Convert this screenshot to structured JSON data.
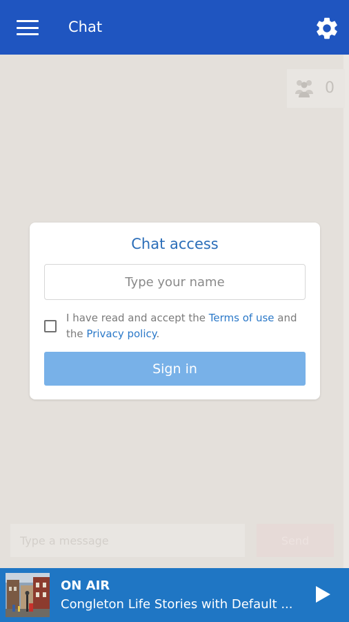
{
  "app_bar": {
    "title": "Chat",
    "menu_icon": "hamburger-menu-icon",
    "settings_icon": "gear-icon",
    "color": "#1f55c0"
  },
  "users": {
    "icon": "users-group-icon",
    "count": "0"
  },
  "chat_access_dialog": {
    "title": "Chat access",
    "name_placeholder": "Type your name",
    "name_value": "",
    "checkbox_checked": false,
    "terms_prefix": "I have read and accept the",
    "terms_link": "Terms of use",
    "terms_middle": "and the",
    "privacy_link": "Privacy policy",
    "terms_suffix": ".",
    "signin_label": "Sign in",
    "accent_color": "#2a6db8",
    "button_color": "#78b1e8"
  },
  "composer": {
    "placeholder": "Type a message",
    "send_label": "Send"
  },
  "player": {
    "status": "ON AIR",
    "track": "Congleton Life Stories with Default ...",
    "play_icon": "play-icon",
    "color": "#1f76c4"
  }
}
